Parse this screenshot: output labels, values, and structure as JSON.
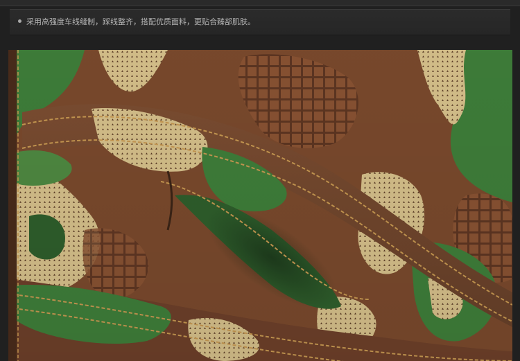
{
  "caption": {
    "text": "采用高强度车线缝制，踩线整齐，搭配优质面料，更贴合臻部肌肤。"
  },
  "photo": {
    "subject": "camouflage-fabric-pocket-closeup",
    "colors": {
      "brown": "#7b4a2d",
      "dark_brown": "#4f2e1c",
      "green": "#3f7f3a",
      "dark_green": "#2f5f2c",
      "sand": "#d7c08a",
      "stitch": "#c99a52"
    }
  }
}
